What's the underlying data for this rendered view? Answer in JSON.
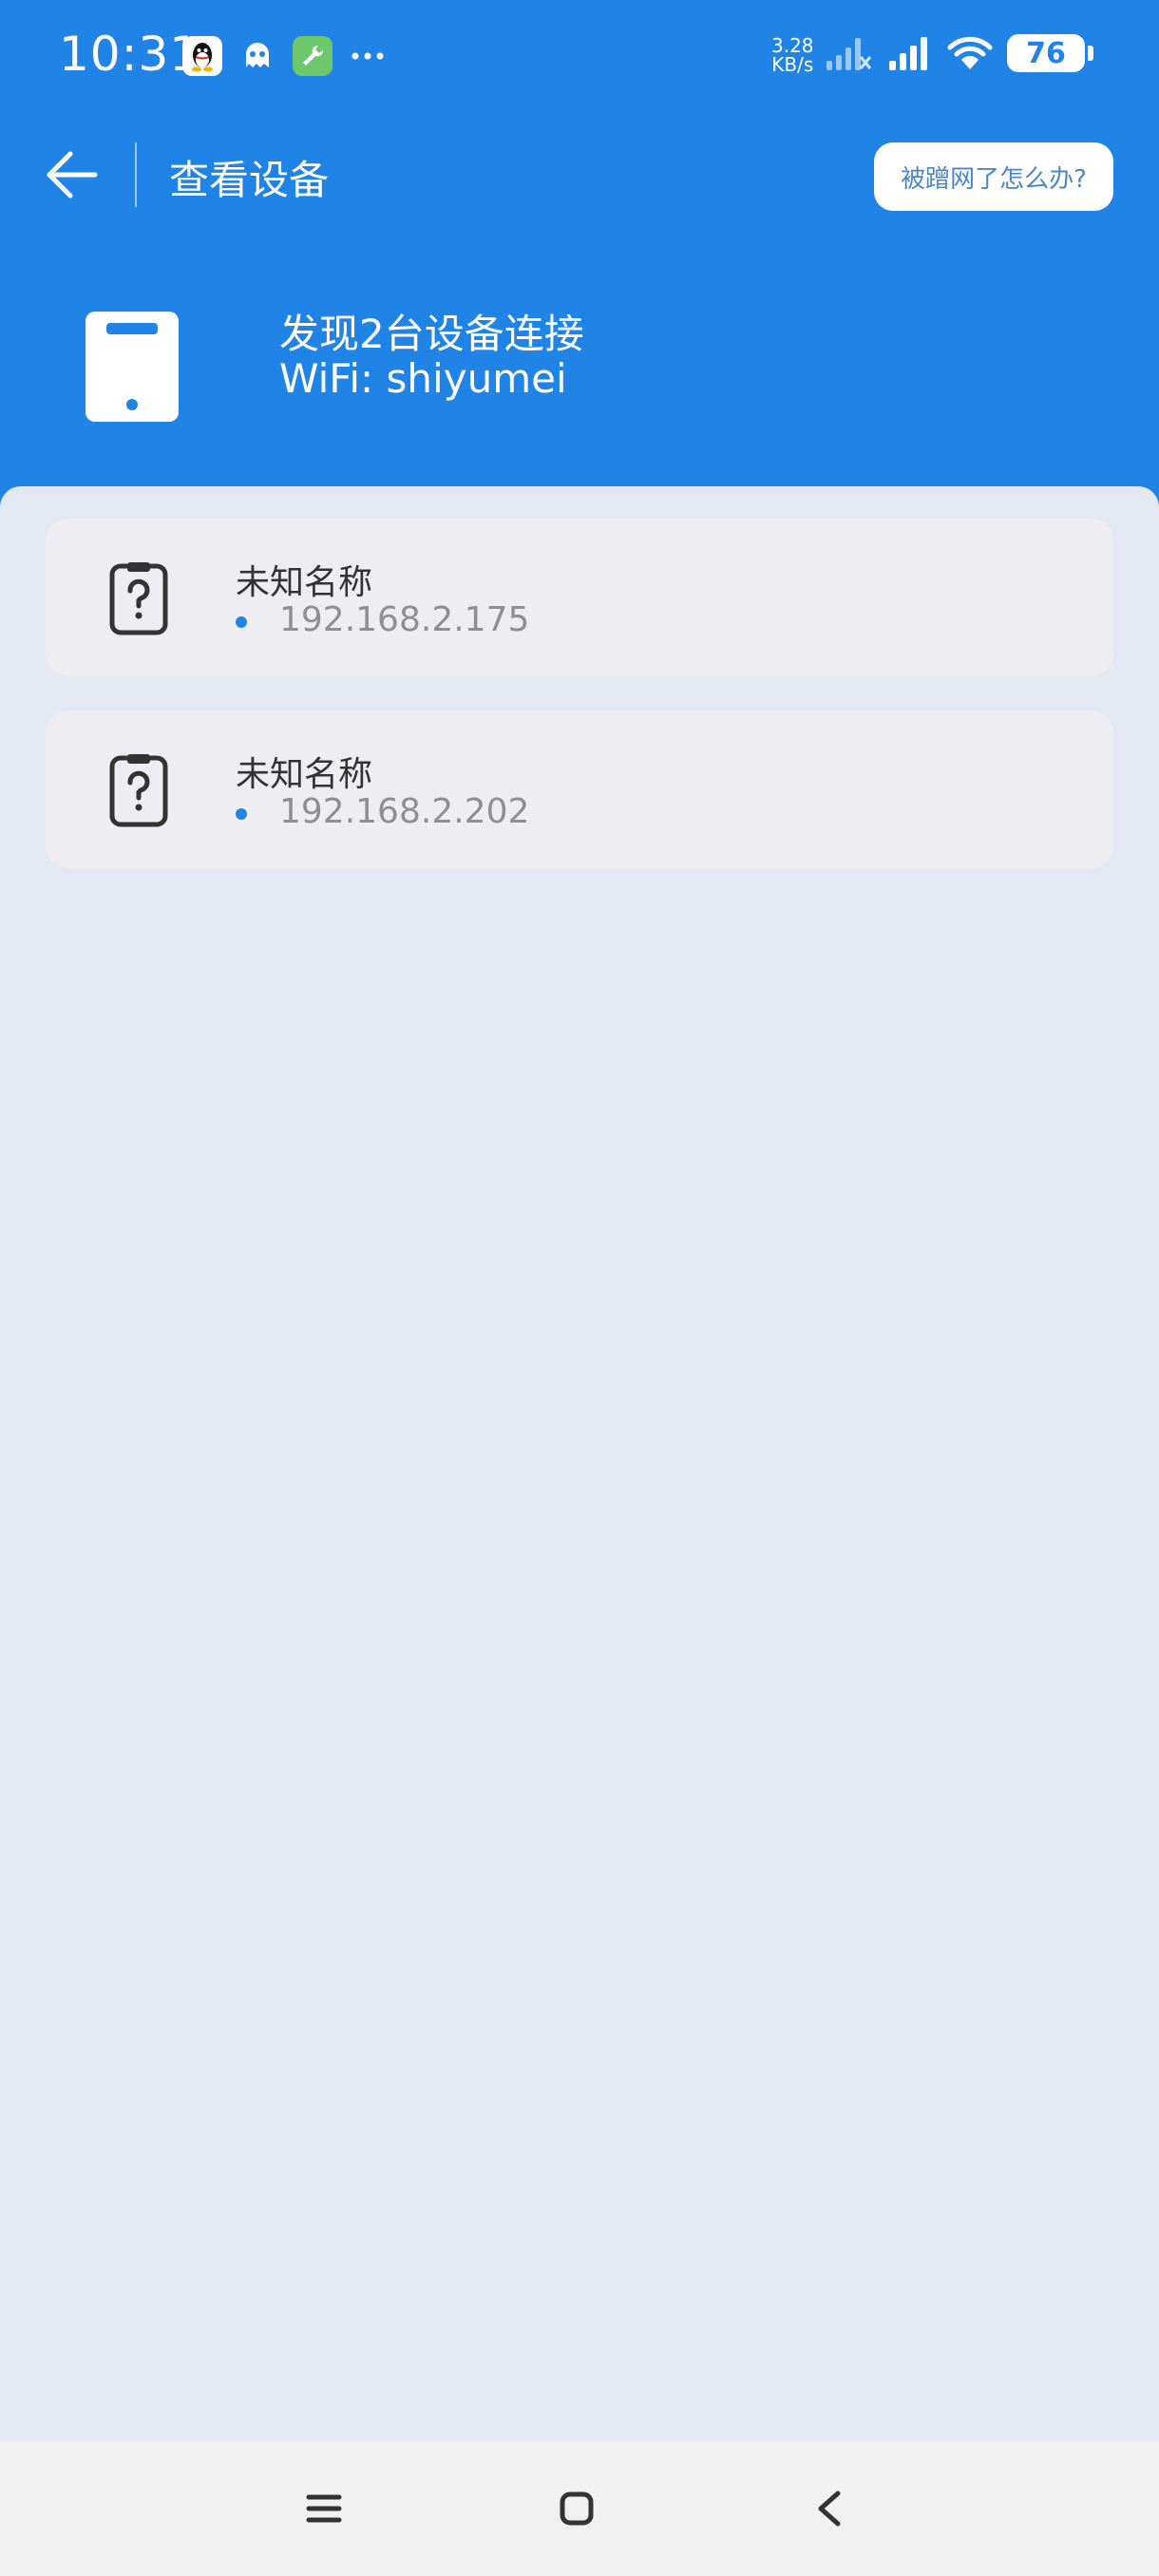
{
  "status_bar": {
    "time": "10:31",
    "speed_value": "3.28",
    "speed_unit": "KB/s",
    "battery": "76"
  },
  "app_bar": {
    "title": "查看设备",
    "help_label": "被蹭网了怎么办?"
  },
  "summary": {
    "count_text": "发现2台设备连接",
    "wifi_text": "WiFi: shiyumei"
  },
  "devices": [
    {
      "name": "未知名称",
      "ip": "192.168.2.175",
      "icon": "unknown-device-icon"
    },
    {
      "name": "未知名称",
      "ip": "192.168.2.202",
      "icon": "unknown-device-icon"
    }
  ],
  "colors": {
    "primary": "#1f84e6",
    "background": "#e4e8f3",
    "card": "#eeeef2"
  }
}
